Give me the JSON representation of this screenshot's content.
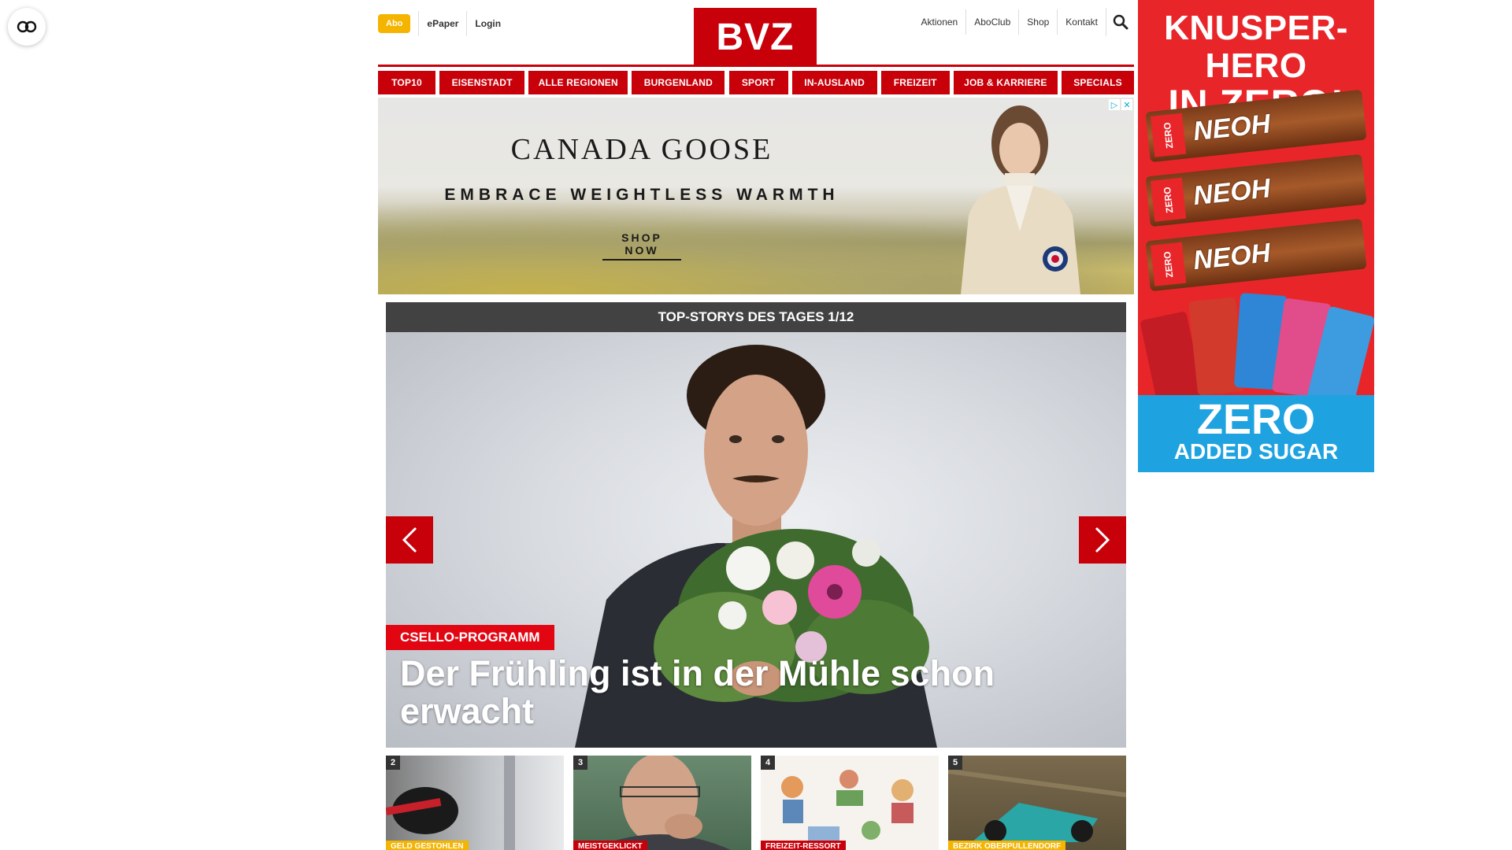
{
  "header": {
    "abo_label": "Abo",
    "links_left": [
      "ePaper",
      "Login"
    ],
    "logo": "BVZ",
    "links_right": [
      "Aktionen",
      "AboClub",
      "Shop",
      "Kontakt"
    ]
  },
  "nav": {
    "items": [
      "TOP10",
      "EISENSTADT",
      "ALLE REGIONEN",
      "BURGENLAND",
      "SPORT",
      "IN-AUSLAND",
      "FREIZEIT",
      "JOB & KARRIERE",
      "SPECIALS"
    ]
  },
  "ad_banner": {
    "brand": "CANADA GOOSE",
    "tagline": "EMBRACE WEIGHTLESS WARMTH",
    "cta": "SHOP NOW"
  },
  "sky_ad": {
    "title_line1": "KNUSPER-HERO",
    "title_line2": "IN ZERO!",
    "product": "NEOH",
    "bottom_line1": "ZERO",
    "bottom_line2": "ADDED SUGAR"
  },
  "top_stories": {
    "header": "TOP-STORYS DES TAGES 1/12",
    "hero_tag": "CSELLO-PROGRAMM",
    "hero_title": "Der Frühling ist in der Mühle schon erwacht"
  },
  "thumbnails": [
    {
      "num": "2",
      "tag": "GELD GESTOHLEN",
      "tag_color": "#f4b400"
    },
    {
      "num": "3",
      "tag": "MEISTGEKLICKT",
      "tag_color": "#c8000a"
    },
    {
      "num": "4",
      "tag": "FREIZEIT-RESSORT",
      "tag_color": "#c8000a"
    },
    {
      "num": "5",
      "tag": "BEZIRK OBERPULLENDORF",
      "tag_color": "#f4b400"
    }
  ],
  "colors": {
    "brand_red": "#c8000a",
    "abo_yellow": "#f4b400",
    "header_dark": "#424242"
  }
}
